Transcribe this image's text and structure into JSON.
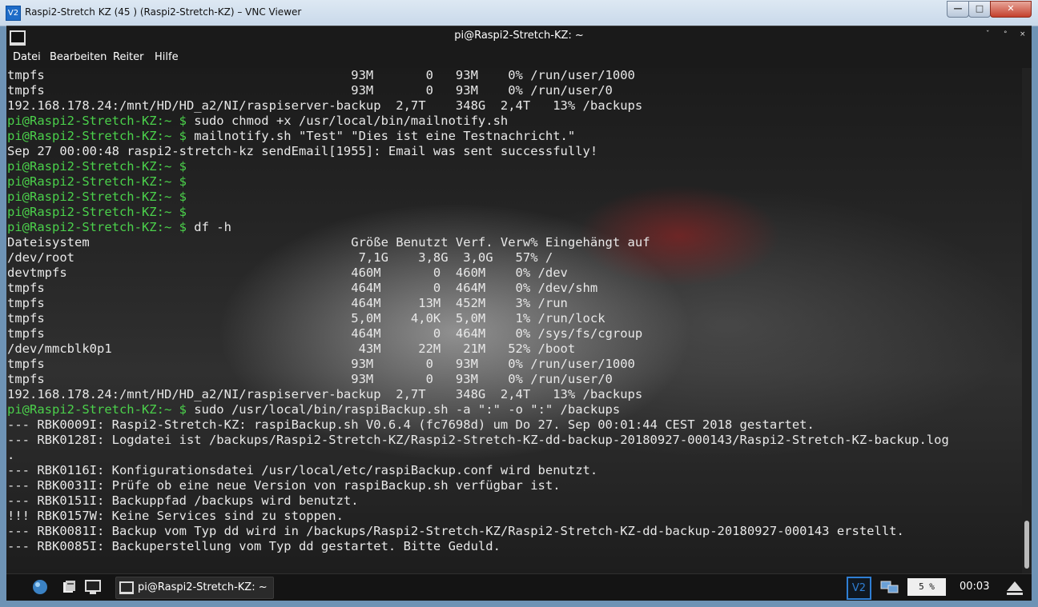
{
  "window": {
    "title": "Raspi2-Stretch KZ (45 ) (Raspi2-Stretch-KZ) – VNC Viewer",
    "app_icon": "V2",
    "minimize_label": "—",
    "maximize_label": "□",
    "close_label": "✕"
  },
  "terminal": {
    "title": "pi@Raspi2-Stretch-KZ: ~",
    "controls": [
      "ˇ",
      "°",
      "×"
    ],
    "menu": [
      "Datei",
      "Bearbeiten",
      "Reiter",
      "Hilfe"
    ],
    "prompt": "pi@Raspi2-Stretch-KZ:~ $",
    "lines": [
      {
        "kind": "text",
        "text": "tmpfs                                         93M       0   93M    0% /run/user/1000"
      },
      {
        "kind": "text",
        "text": "tmpfs                                         93M       0   93M    0% /run/user/0"
      },
      {
        "kind": "text",
        "text": "192.168.178.24:/mnt/HD/HD_a2/NI/raspiserver-backup  2,7T    348G  2,4T   13% /backups"
      },
      {
        "kind": "prompt",
        "text": " sudo chmod +x /usr/local/bin/mailnotify.sh"
      },
      {
        "kind": "prompt",
        "text": " mailnotify.sh \"Test\" \"Dies ist eine Testnachricht.\""
      },
      {
        "kind": "text",
        "text": "Sep 27 00:00:48 raspi2-stretch-kz sendEmail[1955]: Email was sent successfully!"
      },
      {
        "kind": "prompt",
        "text": ""
      },
      {
        "kind": "prompt",
        "text": ""
      },
      {
        "kind": "prompt",
        "text": ""
      },
      {
        "kind": "prompt",
        "text": ""
      },
      {
        "kind": "prompt",
        "text": " df -h"
      },
      {
        "kind": "text",
        "text": "Dateisystem                                   Größe Benutzt Verf. Verw% Eingehängt auf"
      },
      {
        "kind": "text",
        "text": "/dev/root                                      7,1G    3,8G  3,0G   57% /"
      },
      {
        "kind": "text",
        "text": "devtmpfs                                      460M       0  460M    0% /dev"
      },
      {
        "kind": "text",
        "text": "tmpfs                                         464M       0  464M    0% /dev/shm"
      },
      {
        "kind": "text",
        "text": "tmpfs                                         464M     13M  452M    3% /run"
      },
      {
        "kind": "text",
        "text": "tmpfs                                         5,0M    4,0K  5,0M    1% /run/lock"
      },
      {
        "kind": "text",
        "text": "tmpfs                                         464M       0  464M    0% /sys/fs/cgroup"
      },
      {
        "kind": "text",
        "text": "/dev/mmcblk0p1                                 43M     22M   21M   52% /boot"
      },
      {
        "kind": "text",
        "text": "tmpfs                                         93M       0   93M    0% /run/user/1000"
      },
      {
        "kind": "text",
        "text": "tmpfs                                         93M       0   93M    0% /run/user/0"
      },
      {
        "kind": "text",
        "text": "192.168.178.24:/mnt/HD/HD_a2/NI/raspiserver-backup  2,7T    348G  2,4T   13% /backups"
      },
      {
        "kind": "prompt",
        "text": " sudo /usr/local/bin/raspiBackup.sh -a \":\" -o \":\" /backups"
      },
      {
        "kind": "text",
        "text": "--- RBK0009I: Raspi2-Stretch-KZ: raspiBackup.sh V0.6.4 (fc7698d) um Do 27. Sep 00:01:44 CEST 2018 gestartet."
      },
      {
        "kind": "text",
        "text": "--- RBK0128I: Logdatei ist /backups/Raspi2-Stretch-KZ/Raspi2-Stretch-KZ-dd-backup-20180927-000143/Raspi2-Stretch-KZ-backup.log"
      },
      {
        "kind": "text",
        "text": "."
      },
      {
        "kind": "text",
        "text": "--- RBK0116I: Konfigurationsdatei /usr/local/etc/raspiBackup.conf wird benutzt."
      },
      {
        "kind": "text",
        "text": "--- RBK0031I: Prüfe ob eine neue Version von raspiBackup.sh verfügbar ist."
      },
      {
        "kind": "text",
        "text": "--- RBK0151I: Backuppfad /backups wird benutzt."
      },
      {
        "kind": "text",
        "text": "!!! RBK0157W: Keine Services sind zu stoppen."
      },
      {
        "kind": "text",
        "text": "--- RBK0081I: Backup vom Typ dd wird in /backups/Raspi2-Stretch-KZ/Raspi2-Stretch-KZ-dd-backup-20180927-000143 erstellt."
      },
      {
        "kind": "text",
        "text": "--- RBK0085I: Backuperstellung vom Typ dd gestartet. Bitte Geduld."
      }
    ]
  },
  "taskbar": {
    "task_label": "pi@Raspi2-Stretch-KZ: ~",
    "vnc_icon": "V2",
    "cpu": "5 %",
    "clock": "00:03"
  },
  "colors": {
    "prompt": "#4bd14b",
    "text": "#e8e8e8",
    "vnc_accent": "#2f7fd4"
  }
}
